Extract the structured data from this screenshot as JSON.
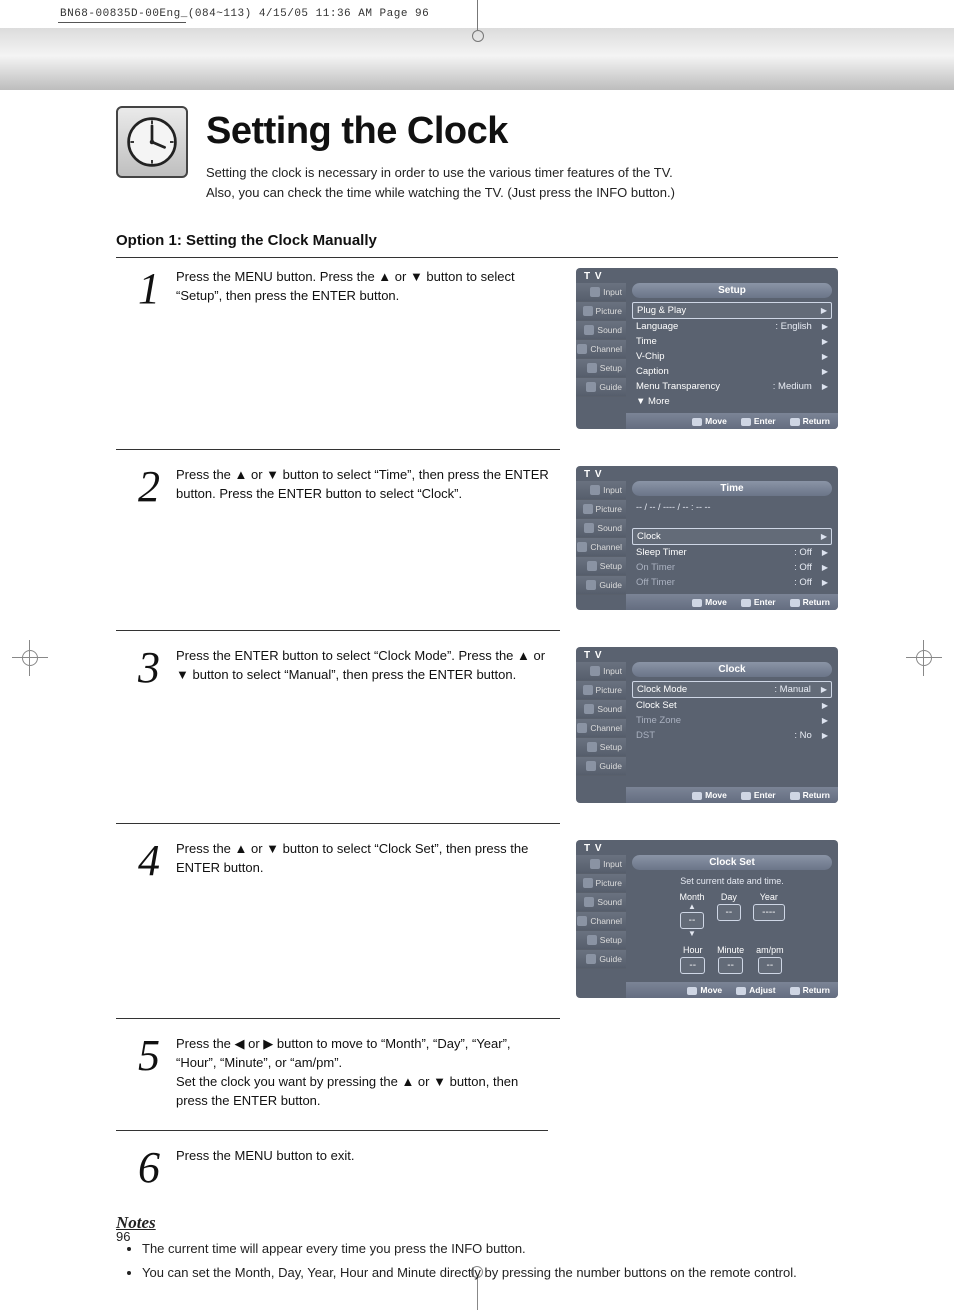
{
  "print_header": "BN68-00835D-00Eng_(084~113)  4/15/05  11:36 AM  Page 96",
  "page_number": "96",
  "title": "Setting the Clock",
  "intro_line1": "Setting the clock is necessary in order to use the various timer features of the TV.",
  "intro_line2": "Also, you can check the time while watching the TV. (Just press the INFO button.)",
  "option1_heading": "Option 1: Setting the Clock Manually",
  "steps": [
    {
      "num": "1",
      "text": "Press the MENU button. Press the ▲ or ▼ button to select “Setup”, then press the ENTER button."
    },
    {
      "num": "2",
      "text": "Press the ▲ or ▼ button to select “Time”, then press the ENTER button. Press the ENTER button to select “Clock”."
    },
    {
      "num": "3",
      "text": "Press the ENTER button to select “Clock Mode”. Press the ▲ or ▼ button to select “Manual”, then press the ENTER button."
    },
    {
      "num": "4",
      "text": "Press the ▲ or ▼ button to select “Clock Set”, then press the ENTER button."
    },
    {
      "num": "5",
      "text": "Press the ◀ or ▶ button to move to “Month”, “Day”, “Year”, “Hour”, “Minute”, or “am/pm”.\nSet the clock you want by pressing the ▲ or ▼ button, then press the ENTER button."
    },
    {
      "num": "6",
      "text": "Press the MENU button to exit."
    }
  ],
  "notes_heading": "Notes",
  "notes": [
    "The current time will appear every time you press the INFO button.",
    "You can set the Month, Day, Year, Hour and Minute directly by pressing the number buttons on the remote control."
  ],
  "osd": {
    "tv_label": "T V",
    "tabs": [
      "Input",
      "Picture",
      "Sound",
      "Channel",
      "Setup",
      "Guide"
    ],
    "hints_default": {
      "move": "Move",
      "enter": "Enter",
      "return": "Return"
    },
    "hints_clockset": {
      "move": "Move",
      "adjust": "Adjust",
      "return": "Return"
    },
    "screen1": {
      "title": "Setup",
      "items": [
        {
          "label": "Plug & Play",
          "value": "",
          "hl": true
        },
        {
          "label": "Language",
          "value": ": English"
        },
        {
          "label": "Time",
          "value": ""
        },
        {
          "label": "V-Chip",
          "value": ""
        },
        {
          "label": "Caption",
          "value": ""
        },
        {
          "label": "Menu Transparency",
          "value": ": Medium"
        },
        {
          "label": "▼ More",
          "value": "",
          "noarr": true
        }
      ]
    },
    "screen2": {
      "title": "Time",
      "time_readout": "-- / -- / ---- / -- : --  --",
      "items": [
        {
          "label": "Clock",
          "value": "",
          "hl": true
        },
        {
          "label": "Sleep Timer",
          "value": ": Off"
        },
        {
          "label": "On Timer",
          "value": ": Off",
          "dim": true
        },
        {
          "label": "Off Timer",
          "value": ": Off",
          "dim": true
        }
      ]
    },
    "screen3": {
      "title": "Clock",
      "items": [
        {
          "label": "Clock Mode",
          "value": ": Manual",
          "hl": true
        },
        {
          "label": "Clock Set",
          "value": ""
        },
        {
          "label": "Time Zone",
          "value": "",
          "dim": true
        },
        {
          "label": "DST",
          "value": ": No",
          "dim": true
        }
      ]
    },
    "screen4": {
      "title": "Clock Set",
      "note": "Set current date and time.",
      "row1": [
        {
          "h": "Month",
          "v": "--",
          "caret": true
        },
        {
          "h": "Day",
          "v": "--"
        },
        {
          "h": "Year",
          "v": "----"
        }
      ],
      "row2": [
        {
          "h": "Hour",
          "v": "--"
        },
        {
          "h": "Minute",
          "v": "--"
        },
        {
          "h": "am/pm",
          "v": "--"
        }
      ]
    }
  }
}
